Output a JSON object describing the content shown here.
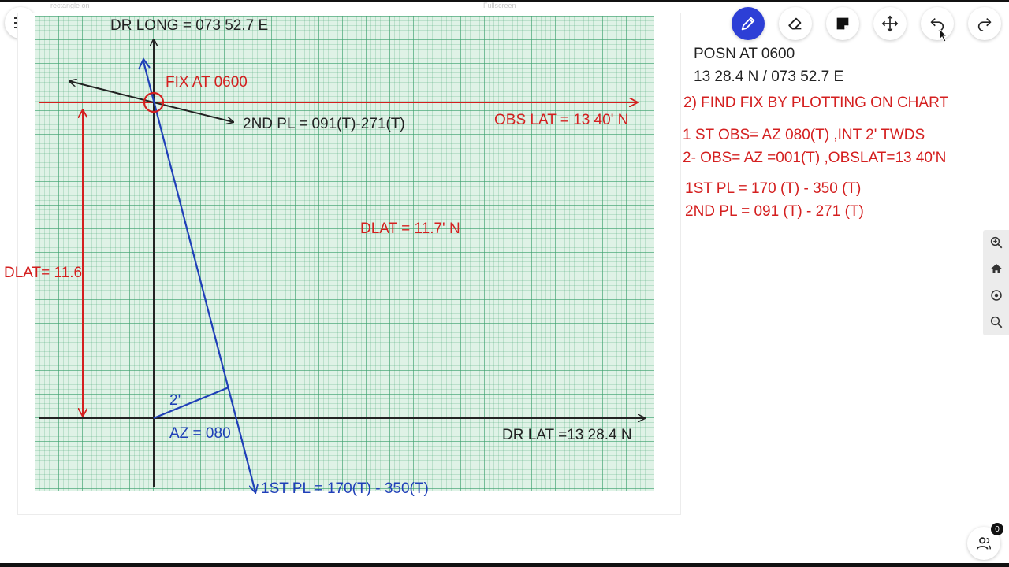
{
  "header": {
    "left_faint_label": "rectangle on",
    "center_faint_label": "Fullscreen"
  },
  "toolbar": {
    "tools": [
      {
        "name": "pencil-icon",
        "active": true
      },
      {
        "name": "eraser-icon",
        "active": false
      },
      {
        "name": "sticky-note-icon",
        "active": false
      },
      {
        "name": "move-icon",
        "active": false
      },
      {
        "name": "undo-icon",
        "active": false
      },
      {
        "name": "redo-icon",
        "active": false
      }
    ]
  },
  "colors": {
    "grid_bg": "#dff2e6",
    "red": "#d41f1f",
    "blue": "#1f3fb8",
    "black": "#222222",
    "active_tool": "#2d3fd6"
  },
  "chart": {
    "dr_long_label": "DR LONG = 073 52.7 E",
    "fix_label": "FIX AT 0600",
    "second_pl_label": "2ND PL = 091(T)-271(T)",
    "obs_lat_label": "OBS LAT = 13  40' N",
    "dlat_center_label": "DLAT = 11.7' N",
    "dlat_left_label": "DLAT= 11.6'",
    "intercept_label": "2'",
    "az_label": "AZ = 080",
    "dr_lat_label": "DR LAT =13  28.4 N",
    "first_pl_label": "1ST PL = 170(T) - 350(T)"
  },
  "notes": {
    "posn_title": "POSN AT 0600",
    "posn_value": "13  28.4 N / 073 52.7 E",
    "task": "2) FIND FIX BY PLOTTING ON CHART",
    "obs1": "1 ST OBS= AZ 080(T) ,INT 2' TWDS",
    "obs2": "2- OBS= AZ =001(T) ,OBSLAT=13 40'N",
    "pl1": "1ST PL = 170 (T) - 350 (T)",
    "pl2": "2ND PL = 091 (T) - 271 (T)"
  },
  "zoom_controls": [
    "zoom-in-icon",
    "home-icon",
    "target-icon",
    "zoom-out-icon"
  ],
  "participants": {
    "count": "0"
  }
}
